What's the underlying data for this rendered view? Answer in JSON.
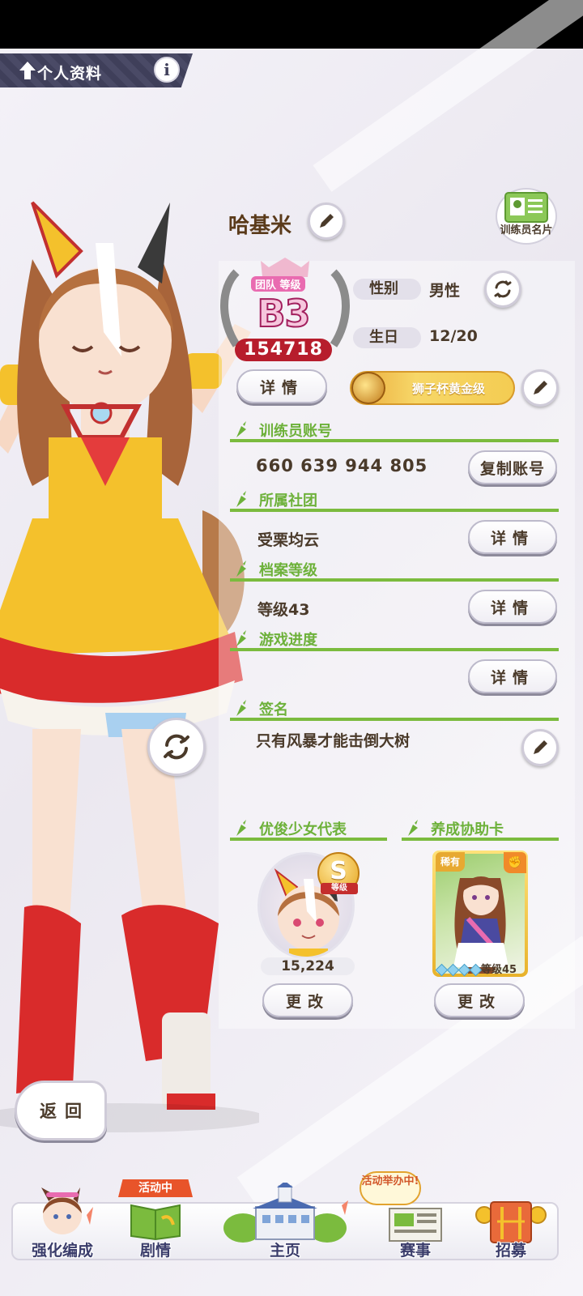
{
  "header": {
    "title": "个人资料",
    "info_icon": "info-icon"
  },
  "profile": {
    "name": "哈基米",
    "trainer_card_label": "训练员名片",
    "rank": {
      "team_label": "团队 等级",
      "grade": "B3",
      "points": "154718"
    },
    "gender_label": "性别",
    "gender_value": "男性",
    "birthday_label": "生日",
    "birthday_value": "12/20",
    "rank_detail_button": "详情",
    "achievement_title": "狮子杯黄金级"
  },
  "sections": {
    "account": {
      "title": "训练员账号",
      "value": "660 639 944 805",
      "button": "复制账号"
    },
    "club": {
      "title": "所属社团",
      "value": "受栗均云",
      "button": "详情"
    },
    "profile_level": {
      "title": "档案等级",
      "value": "等级43",
      "button": "详情"
    },
    "progress": {
      "title": "游戏进度",
      "button": "详情"
    },
    "signature": {
      "title": "签名",
      "value": "只有风暴才能击倒大树"
    }
  },
  "representative": {
    "title": "优俊少女代表",
    "grade": "S",
    "grade_label": "等级",
    "score": "15,224",
    "change_button": "更改"
  },
  "support_card": {
    "title": "养成协助卡",
    "rarity": "稀有",
    "level": "等级45",
    "change_button": "更改"
  },
  "back_button": "返回",
  "bottom_nav": {
    "items": [
      {
        "label": "强化编成"
      },
      {
        "label": "剧情",
        "tag": "活动中"
      },
      {
        "label": "主页"
      },
      {
        "label": "赛事",
        "tag": "活动举办中!"
      },
      {
        "label": "招募"
      }
    ]
  },
  "colors": {
    "accent_green": "#6db13a",
    "header_bg": "#4a4a66",
    "rank_red": "#b71d2c"
  }
}
